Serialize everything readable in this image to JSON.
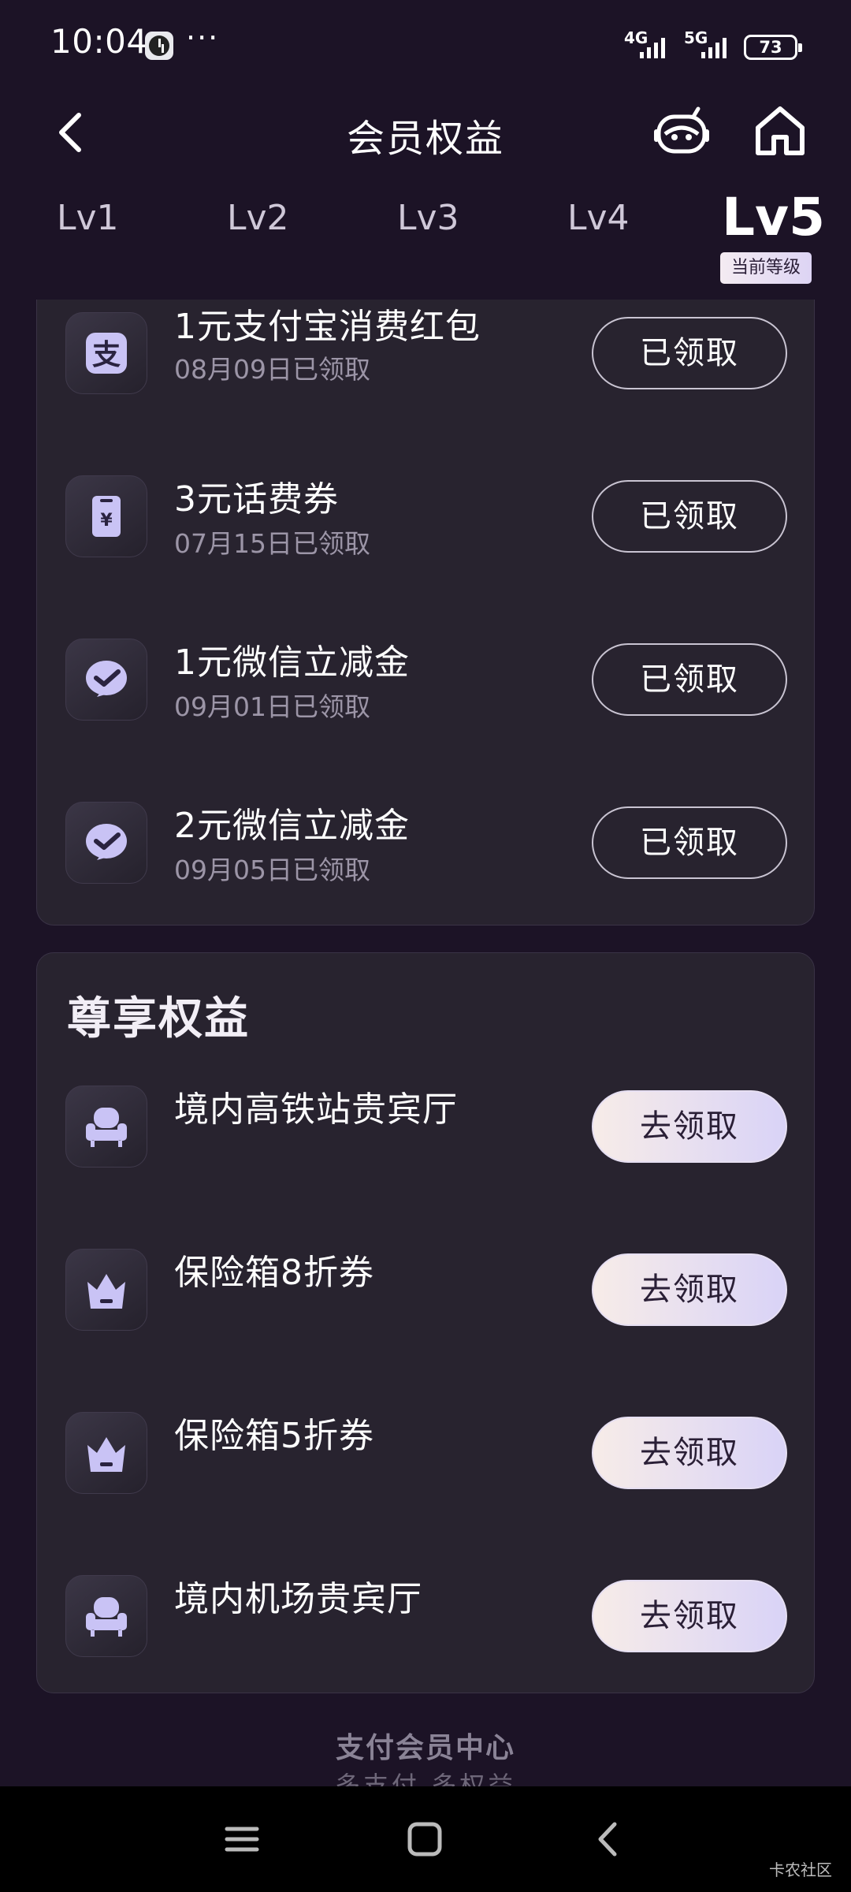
{
  "status_bar": {
    "time": "10:04",
    "dots": "···",
    "net1": "4G",
    "net2": "5G",
    "battery": "73"
  },
  "header": {
    "title": "会员权益"
  },
  "levels": {
    "tabs": [
      "Lv1",
      "Lv2",
      "Lv3",
      "Lv4",
      "Lv5"
    ],
    "active": "Lv5",
    "current_badge": "当前等级"
  },
  "basic_benefits": {
    "items": [
      {
        "title": "1元支付宝消费红包",
        "sub": "08月09日已领取",
        "button": "已领取",
        "icon": "alipay-icon"
      },
      {
        "title": "3元话费券",
        "sub": "07月15日已领取",
        "button": "已领取",
        "icon": "phone-bill-icon"
      },
      {
        "title": "1元微信立减金",
        "sub": "09月01日已领取",
        "button": "已领取",
        "icon": "wechat-pay-icon"
      },
      {
        "title": "2元微信立减金",
        "sub": "09月05日已领取",
        "button": "已领取",
        "icon": "wechat-pay-icon"
      }
    ]
  },
  "premium_benefits": {
    "title": "尊享权益",
    "items": [
      {
        "title": "境内高铁站贵宾厅",
        "button": "去领取",
        "icon": "sofa-icon"
      },
      {
        "title": "保险箱8折券",
        "button": "去领取",
        "icon": "crown-icon"
      },
      {
        "title": "保险箱5折券",
        "button": "去领取",
        "icon": "crown-icon"
      },
      {
        "title": "境内机场贵宾厅",
        "button": "去领取",
        "icon": "sofa-icon"
      }
    ]
  },
  "footer": {
    "brand": "支付会员中心",
    "slogan": "多支付 多权益"
  },
  "watermark": "卡农社区",
  "colors": {
    "background": "#1c1326",
    "card": "#28232f",
    "icon_accent": "#c9c3f5",
    "go_button_start": "#f7ece8",
    "go_button_end": "#d9d3f7"
  }
}
